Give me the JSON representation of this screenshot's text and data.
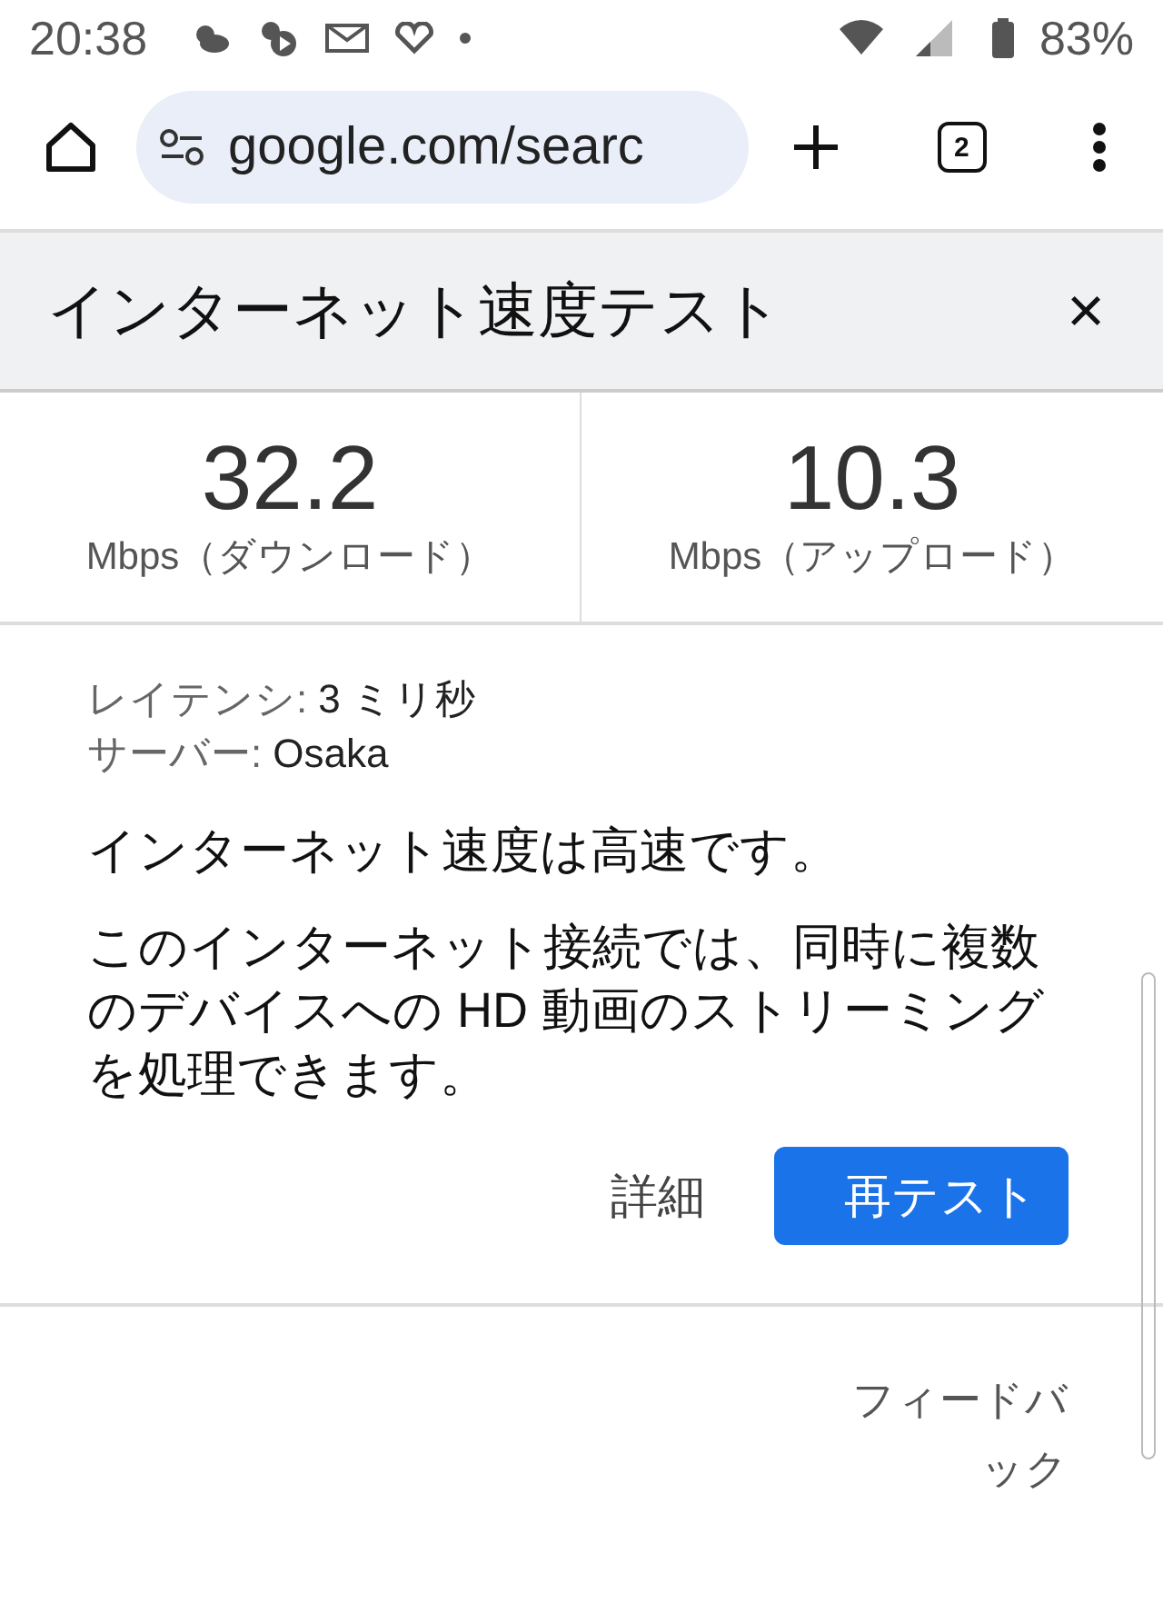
{
  "status_bar": {
    "time": "20:38",
    "battery": "83%"
  },
  "toolbar": {
    "url": "google.com/searc",
    "tab_count": "2"
  },
  "card": {
    "title": "インターネット速度テスト",
    "close": "×",
    "speeds": [
      {
        "value": "32.2",
        "unit": "Mbps（ダウンロード）"
      },
      {
        "value": "10.3",
        "unit": "Mbps（アップロード）"
      }
    ],
    "details": [
      {
        "label": "レイテンシ:",
        "value": "3 ミリ秒"
      },
      {
        "label": "サーバー:",
        "value": "Osaka"
      }
    ],
    "verdict": "インターネット速度は高速です。",
    "description": "このインターネット接続では、同時に複数のデバイスへの HD 動画のストリーミングを処理できます。",
    "buttons": [
      {
        "label": "詳細",
        "kind": "text"
      },
      {
        "label": "再テスト",
        "kind": "primary"
      }
    ],
    "feedback": "フィードバック"
  }
}
